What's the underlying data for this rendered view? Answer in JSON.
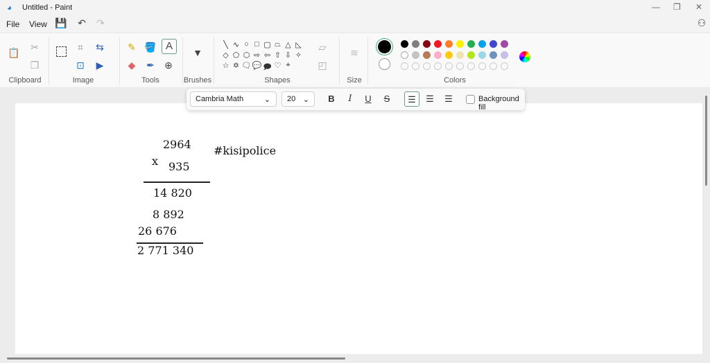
{
  "window": {
    "title": "Untitled - Paint",
    "minimize": "—",
    "maximize": "❐",
    "close": "✕"
  },
  "menu": {
    "file": "File",
    "view": "View"
  },
  "groups": {
    "clipboard": "Clipboard",
    "image": "Image",
    "tools": "Tools",
    "brushes": "Brushes",
    "shapes": "Shapes",
    "size": "Size",
    "colors": "Colors"
  },
  "shapes": [
    "╲",
    "∿",
    "○",
    "□",
    "▢",
    "⏢",
    "△",
    "◺",
    "◇",
    "⬠",
    "⬡",
    "⇨",
    "⇦",
    "⇧",
    "⇩",
    "✧",
    "☆",
    "✡",
    "🗨",
    "💬",
    "🗩",
    "♡",
    "⌖"
  ],
  "colors": {
    "primary": "#000000",
    "secondary": "#ffffff",
    "row1": [
      "#000000",
      "#7f7f7f",
      "#880015",
      "#ed1c24",
      "#ff7f27",
      "#fff200",
      "#22b14c",
      "#00a2e8",
      "#3f48cc",
      "#a349a4"
    ],
    "row2": [
      "#ffffff",
      "#c3c3c3",
      "#b97a57",
      "#ffaec9",
      "#ffc90e",
      "#efe4b0",
      "#b5e61d",
      "#99d9ea",
      "#7092be",
      "#c8bfe7"
    ]
  },
  "text_toolbar": {
    "font": "Cambria Math",
    "size": "20",
    "bold": "B",
    "italic": "I",
    "underline": "U",
    "strike": "S",
    "background_fill": "Background fill"
  },
  "canvas_text": {
    "multiplicand": "2964",
    "operator": "x",
    "multiplier": "935",
    "partial1": "14 820",
    "partial2": "8 892",
    "partial3": "26 676",
    "result": "2 771 340",
    "hashtag": "#kisipolice"
  }
}
